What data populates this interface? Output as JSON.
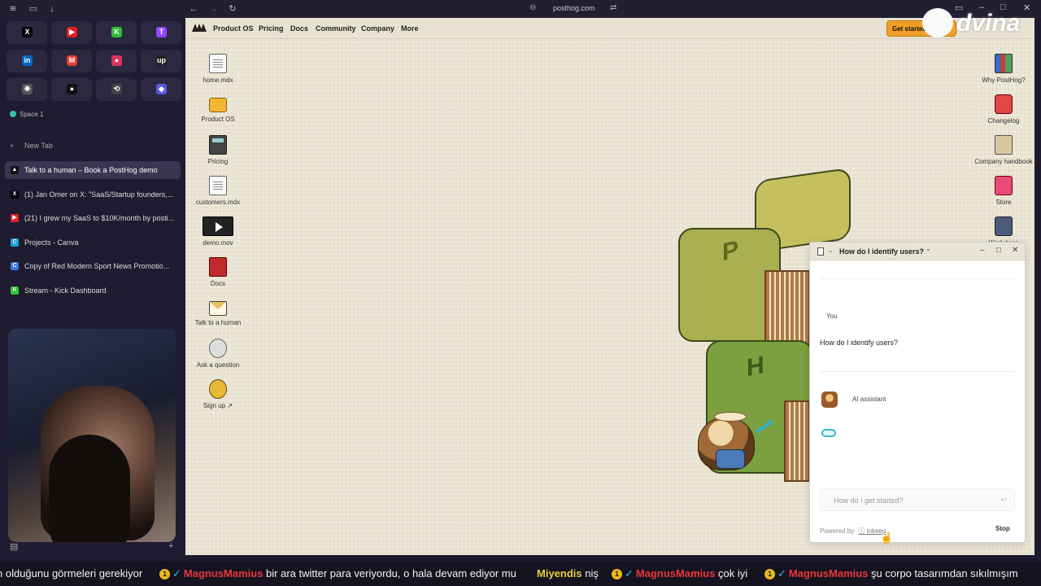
{
  "browser": {
    "url": "posthog.com"
  },
  "sidebar": {
    "pinned": [
      {
        "icon": "x-icon",
        "glyph": "X",
        "color": "#000000"
      },
      {
        "icon": "youtube-icon",
        "glyph": "▶",
        "color": "#e02020"
      },
      {
        "icon": "kick-icon",
        "glyph": "K",
        "color": "#30c030"
      },
      {
        "icon": "twitch-icon",
        "glyph": "T",
        "color": "#9146ff"
      },
      {
        "icon": "linkedin-icon",
        "glyph": "in",
        "color": "#0a66c2"
      },
      {
        "icon": "gmail-icon",
        "glyph": "M",
        "color": "#e04030"
      },
      {
        "icon": "record-icon",
        "glyph": "●",
        "color": "#e0305a"
      },
      {
        "icon": "upwork-icon",
        "glyph": "up",
        "color": "#222222"
      },
      {
        "icon": "openai-icon",
        "glyph": "❋",
        "color": "#555555"
      },
      {
        "icon": "notion-icon",
        "glyph": "●",
        "color": "#111111"
      },
      {
        "icon": "sync-icon",
        "glyph": "⟲",
        "color": "#444444"
      },
      {
        "icon": "linear-icon",
        "glyph": "◆",
        "color": "#5a5ae0"
      }
    ],
    "space_label": "Space 1",
    "new_tab_label": "New Tab",
    "tabs": [
      {
        "title": "Talk to a human – Book a PostHog demo",
        "fav": "▲",
        "color": "#111111",
        "active": true
      },
      {
        "title": "(1) Jan Omer on X: \"SaaS/Startup founders,...",
        "fav": "X",
        "color": "#000000",
        "active": false
      },
      {
        "title": "(21) I grew my SaaS to $10K/month by posti...",
        "fav": "▶",
        "color": "#e02020",
        "active": false
      },
      {
        "title": "Projects - Canva",
        "fav": "C",
        "color": "#1aa0d8",
        "active": false
      },
      {
        "title": "Copy of Red Modern Sport News Promotio...",
        "fav": "C",
        "color": "#3a7ae0",
        "active": false
      },
      {
        "title": "Stream - Kick Dashboard",
        "fav": "K",
        "color": "#30c030",
        "active": false
      }
    ]
  },
  "site": {
    "nav": [
      "Product OS",
      "Pricing",
      "Docs",
      "Community",
      "Company",
      "More"
    ],
    "get_started": "Get started",
    "overlay_brand": "dvina",
    "desktop_left": [
      {
        "label": "home.mdx",
        "icon": "document-icon",
        "cls": "g-doc"
      },
      {
        "label": "Product OS",
        "icon": "folder-icon",
        "cls": "g-folder"
      },
      {
        "label": "Pricing",
        "icon": "calculator-icon",
        "cls": "g-calc"
      },
      {
        "label": "customers.mdx",
        "icon": "document-icon",
        "cls": "g-doc"
      },
      {
        "label": "demo.mov",
        "icon": "video-icon",
        "cls": "g-video"
      },
      {
        "label": "Docs",
        "icon": "book-icon",
        "cls": "g-book"
      },
      {
        "label": "Talk to a human",
        "icon": "envelope-icon",
        "cls": "g-mail"
      },
      {
        "label": "Ask a question",
        "icon": "chat-bubble-icon",
        "cls": "g-bubble"
      },
      {
        "label": "Sign up ↗",
        "icon": "signup-icon",
        "cls": "g-sign"
      }
    ],
    "desktop_right": [
      {
        "label": "Why PostHog?",
        "icon": "books-icon",
        "cls": "g-bookset"
      },
      {
        "label": "Changelog",
        "icon": "changelog-icon",
        "cls": "g-changelog"
      },
      {
        "label": "Company handbook",
        "icon": "handbook-icon",
        "cls": "g-handbook"
      },
      {
        "label": "Store",
        "icon": "store-icon",
        "cls": "g-store"
      },
      {
        "label": "Work here",
        "icon": "typewriter-icon",
        "cls": "g-typewriter"
      }
    ],
    "hedge_letters": [
      "P",
      "H"
    ]
  },
  "chat": {
    "title": "How do I identify users?",
    "user_role": "You",
    "user_message": "How do I identify users?",
    "assistant_role": "AI assistant",
    "input_placeholder": "How do I get started?",
    "powered_by": "Powered by",
    "powered_brand": "inkeep",
    "stop_label": "Stop"
  },
  "ticker": {
    "items": [
      {
        "text": "n olduğunu görmeleri gerekiyor"
      },
      {
        "badge": "1",
        "name": "MagnusMamius",
        "text": "bir ara twitter para veriyordu, o hala devam ediyor mu"
      },
      {
        "name_y": "Miyendis",
        "text": "niş"
      },
      {
        "badge": "1",
        "name": "MagnusMamius",
        "text": "çok iyi"
      },
      {
        "badge": "1",
        "name": "MagnusMamius",
        "text": "şu corpo tasarımdan sıkılmışım"
      }
    ]
  },
  "colors": {
    "accent": "#f0a028",
    "sidebar_bg": "#1f1b30",
    "desktop_bg": "#ece6d6",
    "ticker_name": "#e8363c"
  }
}
